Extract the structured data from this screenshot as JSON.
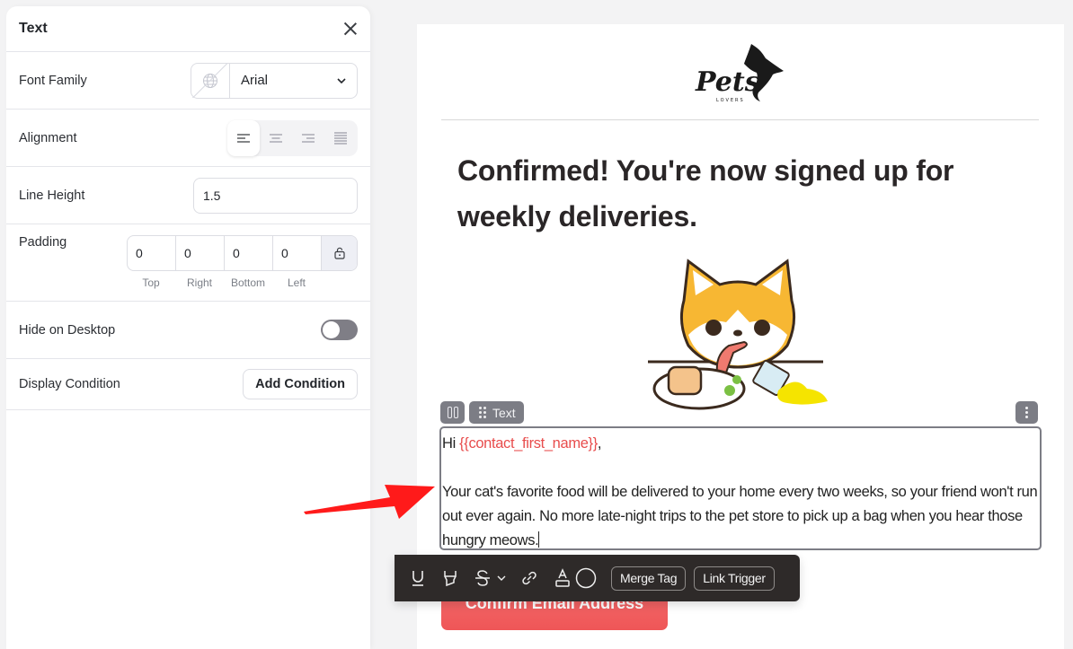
{
  "panel": {
    "title": "Text",
    "font_family": {
      "label": "Font Family",
      "value": "Arial"
    },
    "alignment": {
      "label": "Alignment",
      "options": [
        "left",
        "center",
        "right",
        "justify"
      ],
      "selected": "left"
    },
    "line_height": {
      "label": "Line Height",
      "value": "1.5"
    },
    "padding": {
      "label": "Padding",
      "values": {
        "top": "0",
        "right": "0",
        "bottom": "0",
        "left": "0"
      },
      "sublabels": {
        "top": "Top",
        "right": "Right",
        "bottom": "Bottom",
        "left": "Left"
      }
    },
    "hide_on_desktop": {
      "label": "Hide on Desktop",
      "enabled": false
    },
    "display_condition": {
      "label": "Display Condition",
      "button": "Add Condition"
    }
  },
  "email": {
    "logo_alt": "Pets Lovers",
    "heading": "Confirmed! You're now signed up for weekly deliveries.",
    "block_tag": "Text",
    "greeting_prefix": "Hi ",
    "merge_tag": "{{contact_first_name}}",
    "greeting_suffix": ",",
    "body": "Your cat's favorite food will be delivered to your home every two weeks, so your friend won't run out ever again. No more late-night trips to the pet store to pick up a bag when you hear those hungry meows.",
    "cta": "Confirm Email Address"
  },
  "format_toolbar": {
    "merge_tag": "Merge Tag",
    "link_trigger": "Link Trigger"
  },
  "colors": {
    "merge_tag": "#e84c4c",
    "cta": "#ef5657",
    "toolbar_bg": "#2e2a29",
    "block_outline": "#7c7d85",
    "annotation_arrow": "#ff1a1a"
  }
}
